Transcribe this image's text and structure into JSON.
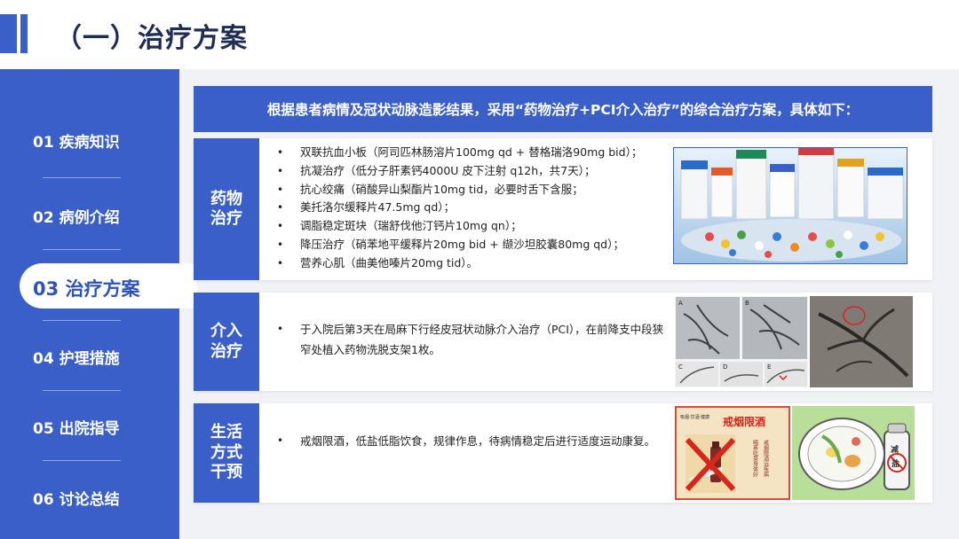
{
  "header": {
    "title": "（一）治疗方案"
  },
  "sidebar": {
    "items": [
      {
        "label": "01 疾病知识"
      },
      {
        "label": "02 病例介绍"
      },
      {
        "label": "03 治疗方案",
        "active": true
      },
      {
        "label": "04 护理措施"
      },
      {
        "label": "05 出院指导"
      },
      {
        "label": "06 讨论总结"
      }
    ]
  },
  "banner": {
    "text": "根据患者病情及冠状动脉造影结果，采用“药物治疗+PCI介入治疗”的综合治疗方案，具体如下："
  },
  "sections": {
    "drug": {
      "label": "药物治疗",
      "items": [
        "双联抗血小板（阿司匹林肠溶片100mg qd + 替格瑞洛90mg bid）；",
        "抗凝治疗（低分子肝素钙4000U 皮下注射 q12h，共7天）；",
        "抗心绞痛（硝酸异山梨酯片10mg tid，必要时舌下含服；",
        "美托洛尔缓释片47.5mg qd）；",
        "调脂稳定斑块（瑞舒伐他汀钙片10mg qn）；",
        "降压治疗（硝苯地平缓释片20mg bid + 缬沙坦胶囊80mg qd）；",
        "营养心肌（曲美他嗪片20mg tid）。"
      ]
    },
    "intervention": {
      "label": "介入治疗",
      "text": "于入院后第3天在局麻下行经皮冠状动脉介入治疗（PCI），在前降支中段狭窄处植入药物洗脱支架1枚。"
    },
    "lifestyle": {
      "label": "生活方式干预",
      "text": "戒烟限酒，低盐低脂饮食，规律作息，待病情稳定后进行适度运动康复。"
    }
  },
  "images": {
    "angiogram_panels": [
      "A",
      "B",
      "C",
      "D",
      "E"
    ],
    "poster_title": "戒烟限酒",
    "poster_small": "吸烟·饮酒·健康",
    "poster_side": "戒烟限酒远疾病",
    "poster_side2": "喝茶吃菜身体好",
    "salt_label_top": "减",
    "salt_label_bottom": "盐"
  },
  "colors": {
    "accent": "#3a5fc8",
    "title": "#1f2d55",
    "background": "#f0f2f6"
  }
}
